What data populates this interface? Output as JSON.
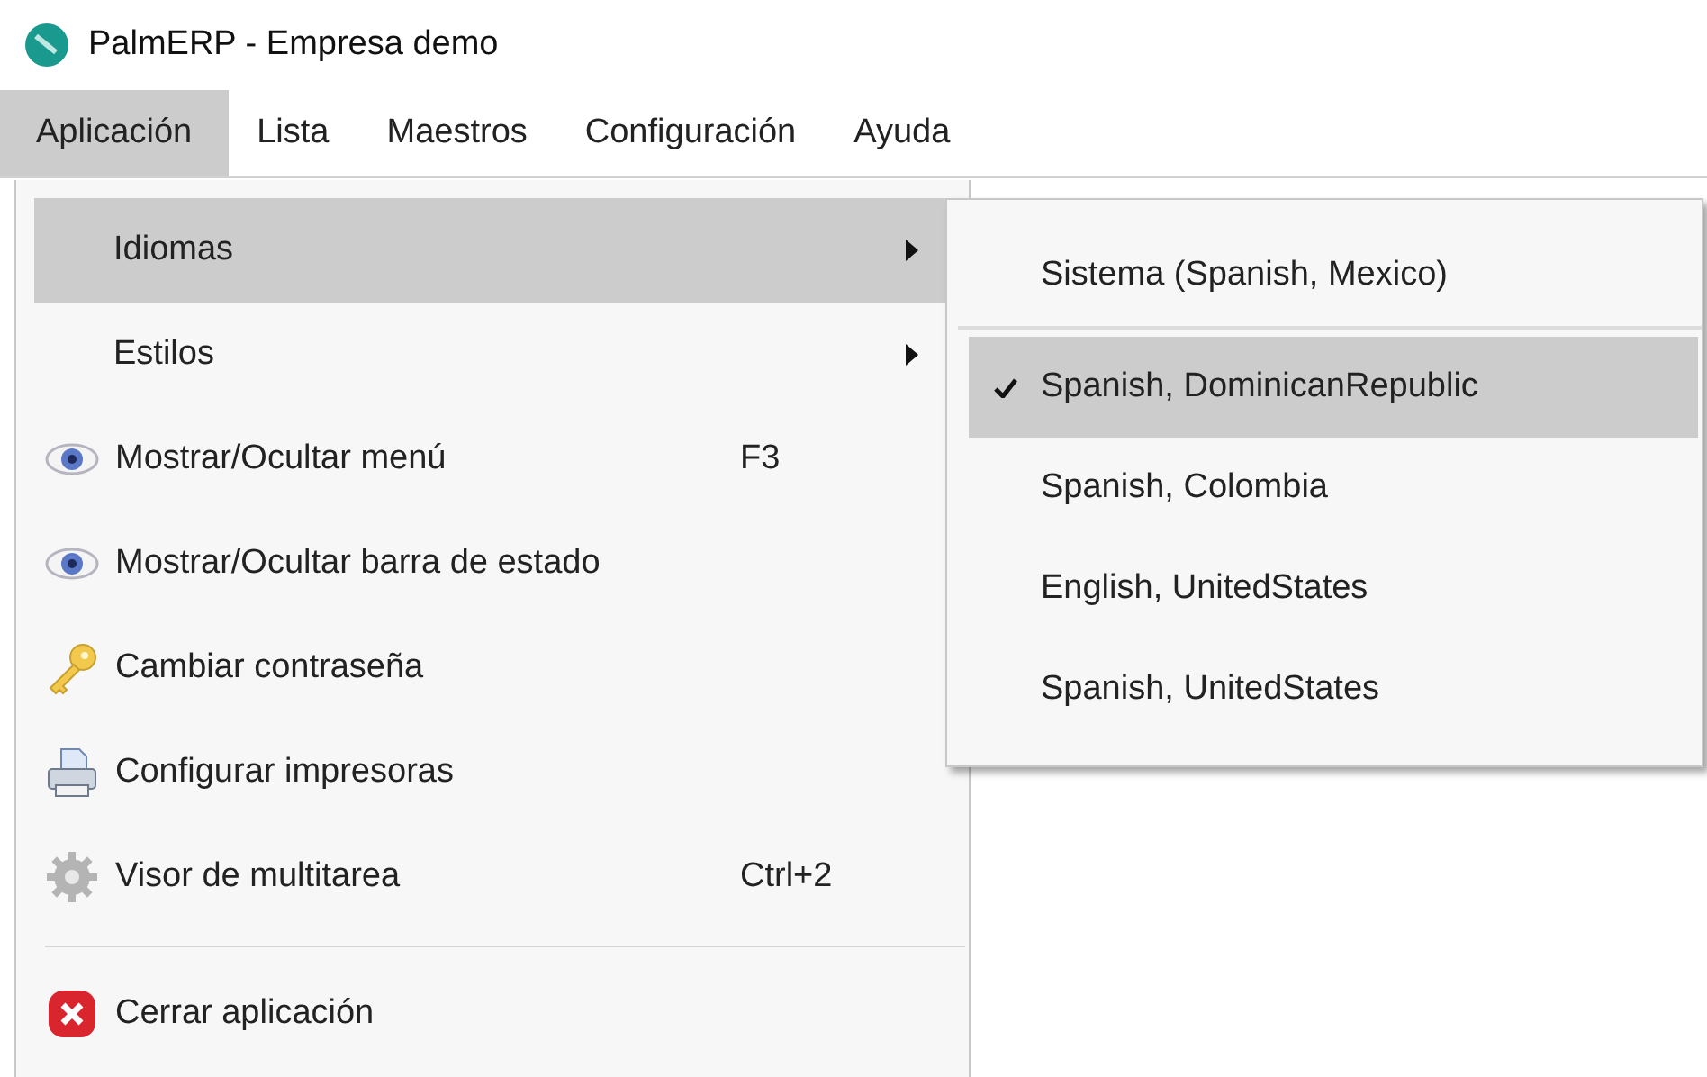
{
  "window": {
    "title": "PalmERP - Empresa demo"
  },
  "menu_bar": [
    {
      "label": "Aplicación",
      "selected": true
    },
    {
      "label": "Lista",
      "selected": false
    },
    {
      "label": "Maestros",
      "selected": false
    },
    {
      "label": "Configuración",
      "selected": false
    },
    {
      "label": "Ayuda",
      "selected": false
    }
  ],
  "application_menu": [
    {
      "kind": "submenu",
      "label": "Idiomas",
      "selected": true
    },
    {
      "kind": "submenu",
      "label": "Estilos",
      "selected": false
    },
    {
      "kind": "command",
      "label": "Mostrar/Ocultar menú",
      "shortcut": "F3"
    },
    {
      "kind": "command",
      "label": "Mostrar/Ocultar barra de estado"
    },
    {
      "kind": "command",
      "label": "Cambiar contraseña"
    },
    {
      "kind": "command",
      "label": "Configurar impresoras"
    },
    {
      "kind": "command",
      "label": "Visor de multitarea",
      "shortcut": "Ctrl+2"
    },
    {
      "kind": "separator"
    },
    {
      "kind": "command",
      "label": "Cerrar aplicación"
    }
  ],
  "languages_submenu": [
    {
      "kind": "option",
      "label": "Sistema (Spanish, Mexico)",
      "checked": false,
      "selected": false
    },
    {
      "kind": "separator"
    },
    {
      "kind": "option",
      "label": "Spanish, DominicanRepublic",
      "checked": true,
      "selected": true
    },
    {
      "kind": "option",
      "label": "Spanish, Colombia",
      "checked": false,
      "selected": false
    },
    {
      "kind": "option",
      "label": "English, UnitedStates",
      "checked": false,
      "selected": false
    },
    {
      "kind": "option",
      "label": "Spanish, UnitedStates",
      "checked": false,
      "selected": false
    }
  ]
}
